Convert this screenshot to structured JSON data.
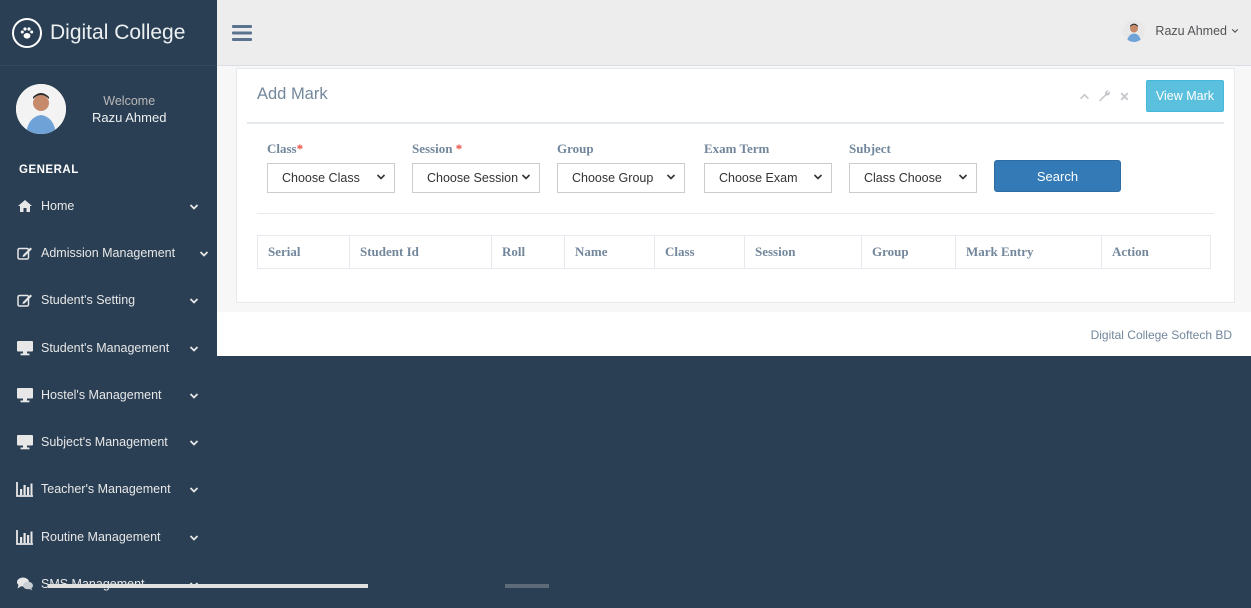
{
  "brand": {
    "title": "Digital College",
    "icon": "paw-icon"
  },
  "profile": {
    "welcome": "Welcome",
    "name": "Razu Ahmed"
  },
  "sidebar": {
    "section_title": "GENERAL",
    "items": [
      {
        "label": "Home",
        "icon": "home-icon"
      },
      {
        "label": "Admission Management",
        "icon": "edit-icon"
      },
      {
        "label": "Student's Setting",
        "icon": "edit-icon"
      },
      {
        "label": "Student's Management",
        "icon": "desktop-icon"
      },
      {
        "label": "Hostel's Management",
        "icon": "desktop-icon"
      },
      {
        "label": "Subject's Management",
        "icon": "desktop-icon"
      },
      {
        "label": "Teacher's Management",
        "icon": "bar-chart-icon"
      },
      {
        "label": "Routine Management",
        "icon": "bar-chart-icon"
      },
      {
        "label": "SMS Management",
        "icon": "comments-icon"
      }
    ]
  },
  "topbar": {
    "user_name": "Razu Ahmed"
  },
  "panel": {
    "title": "Add Mark",
    "view_button": "View Mark",
    "filters": {
      "class": {
        "label": "Class",
        "value": "Choose Class"
      },
      "session": {
        "label": "Session",
        "value": "Choose Session"
      },
      "group": {
        "label": "Group",
        "value": "Choose Group"
      },
      "exam_term": {
        "label": "Exam Term",
        "value": "Choose Exam"
      },
      "subject": {
        "label": "Subject",
        "value": "Class Choose"
      }
    },
    "required_mark": "*",
    "search_button": "Search",
    "table_headers": [
      "Serial",
      "Student Id",
      "Roll",
      "Name",
      "Class",
      "Session",
      "Group",
      "Mark Entry",
      "Action"
    ]
  },
  "footer": {
    "text": "Digital College Softech BD"
  },
  "colors": {
    "sidebar_bg": "#2a3f54",
    "view_button": "#5bc0de",
    "search_button": "#337ab7",
    "required": "#e74c3c"
  }
}
